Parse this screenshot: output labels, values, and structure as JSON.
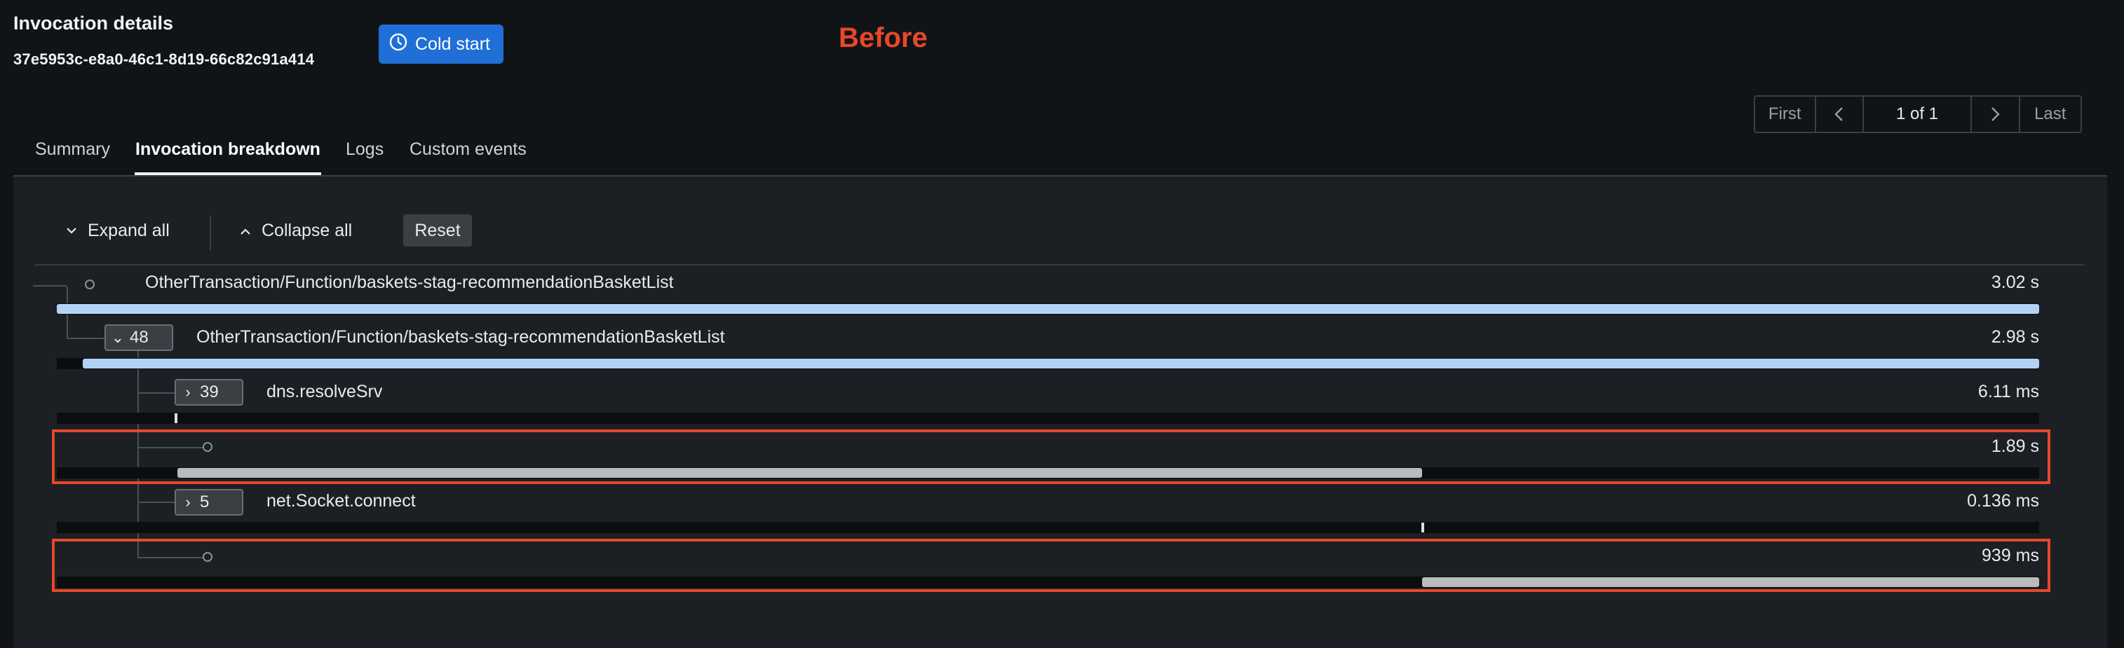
{
  "header": {
    "title": "Invocation details",
    "invocation_id": "37e5953c-e8a0-46c1-8d19-66c82c91a414",
    "cold_start_label": "Cold start",
    "annotation": "Before"
  },
  "pager": {
    "first": "First",
    "count": "1 of 1",
    "last": "Last"
  },
  "tabs": [
    {
      "label": "Summary",
      "active": false
    },
    {
      "label": "Invocation breakdown",
      "active": true
    },
    {
      "label": "Logs",
      "active": false
    },
    {
      "label": "Custom events",
      "active": false
    }
  ],
  "toolbar": {
    "expand_all": "Expand all",
    "collapse_all": "Collapse all",
    "reset": "Reset"
  },
  "trace": {
    "rows": [
      {
        "name": "OtherTransaction/Function/baskets-stag-recommendationBasketList",
        "duration": "3.02 s",
        "badge": null
      },
      {
        "name": "OtherTransaction/Function/baskets-stag-recommendationBasketList",
        "duration": "2.98 s",
        "badge": "48"
      },
      {
        "name": "dns.resolveSrv",
        "duration": "6.11 ms",
        "badge": "39"
      },
      {
        "name": "",
        "duration": "1.89 s",
        "badge": null,
        "highlighted": true
      },
      {
        "name": "net.Socket.connect",
        "duration": "0.136 ms",
        "badge": "5"
      },
      {
        "name": "",
        "duration": "939 ms",
        "badge": null,
        "highlighted": true
      }
    ]
  },
  "colors": {
    "accent": "#1f6fd6",
    "highlight": "#e8472a",
    "bar_blue": "#b3d3f5",
    "bar_gray": "#b9bbbd"
  }
}
